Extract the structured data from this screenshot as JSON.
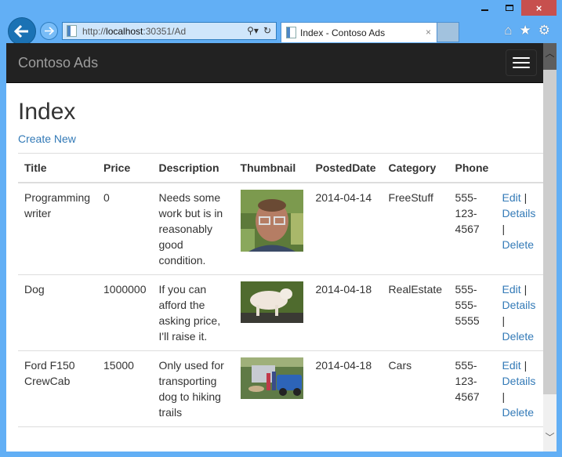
{
  "browser": {
    "url_prefix": "http://",
    "url_host": "localhost",
    "url_suffix": ":30351/Ad",
    "tab_title": "Index - Contoso Ads",
    "tab_close": "×",
    "window_close": "×",
    "icons": {
      "back": "back-arrow-icon",
      "forward": "forward-arrow-icon",
      "search": "search-icon",
      "refresh": "refresh-icon",
      "home": "home-icon",
      "favorites": "star-icon",
      "settings": "gear-icon"
    }
  },
  "navbar": {
    "brand": "Contoso Ads"
  },
  "page": {
    "title": "Index",
    "create_new": "Create New"
  },
  "table": {
    "headers": [
      "Title",
      "Price",
      "Description",
      "Thumbnail",
      "PostedDate",
      "Category",
      "Phone",
      ""
    ],
    "rows": [
      {
        "title": "Programming writer",
        "price": "0",
        "description": "Needs some work but is in reasonably good condition.",
        "thumbnail": "photo of man with glasses",
        "posted_date": "2014-04-14",
        "category": "FreeStuff",
        "phone": "555-123-4567",
        "edit": "Edit",
        "details": "Details",
        "delete": "Delete"
      },
      {
        "title": "Dog",
        "price": "1000000",
        "description": "If you can afford the asking price, I'll raise it.",
        "thumbnail": "photo of white dog",
        "posted_date": "2014-04-18",
        "category": "RealEstate",
        "phone": "555-555-5555",
        "edit": "Edit",
        "details": "Details",
        "delete": "Delete"
      },
      {
        "title": "Ford F150 CrewCab",
        "price": "15000",
        "description": "Only used for transporting dog to hiking trails",
        "thumbnail": "photo of blue truck with people",
        "posted_date": "2014-04-18",
        "category": "Cars",
        "phone": "555-123-4567",
        "edit": "Edit",
        "details": "Details",
        "delete": "Delete"
      }
    ],
    "separator": "|"
  }
}
